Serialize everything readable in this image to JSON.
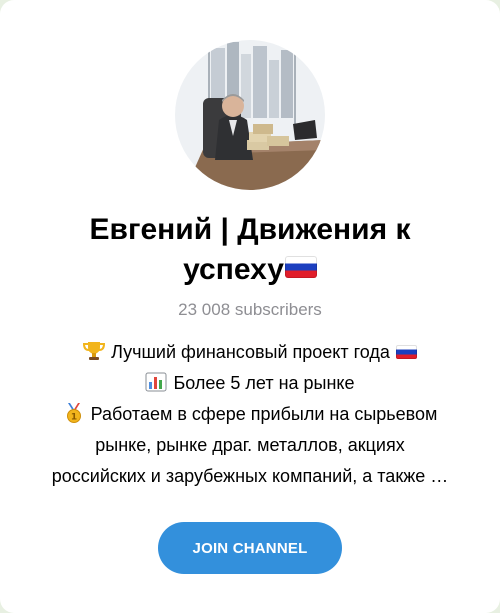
{
  "channel": {
    "title": "Евгений | Движения к успеху",
    "subscribers": "23 008 subscribers",
    "avatar_alt": "channel-avatar"
  },
  "description": {
    "lines": [
      {
        "icon": "trophy-icon",
        "text": "Лучший финансовый проект года",
        "trailing_icon": "russian-flag-icon"
      },
      {
        "icon": "bar-chart-icon",
        "text": "Более 5 лет на рынке"
      },
      {
        "icon": "medal-icon",
        "text": "Работаем в сфере прибыли на сырьевом"
      },
      {
        "text": "рынке, рынке драг. металлов, акциях"
      },
      {
        "text": "российских и зарубежных компаний, а также …"
      }
    ]
  },
  "actions": {
    "join_label": "JOIN CHANNEL"
  },
  "colors": {
    "accent": "#3390dc",
    "background": "#e8f0e2",
    "card": "#ffffff",
    "muted_text": "#8e8e93"
  }
}
